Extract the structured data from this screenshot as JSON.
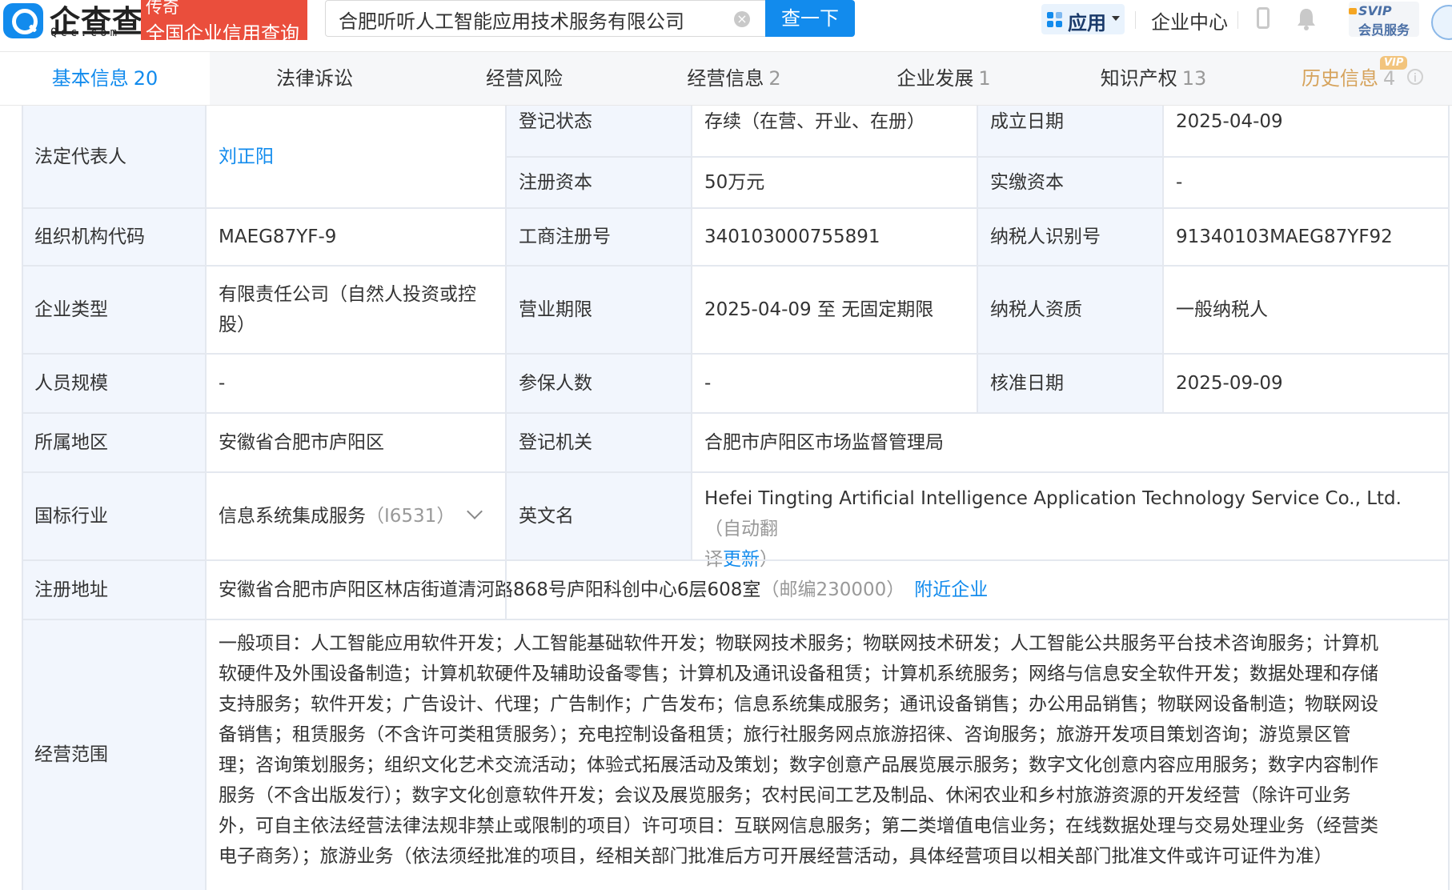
{
  "logo": {
    "name": "企查查",
    "domain": "Qcc.com",
    "badge_line1": "传奇",
    "badge_line2": "全国企业信用查询"
  },
  "search": {
    "value": "合肥听听人工智能应用技术服务有限公司",
    "button_label": "查一下"
  },
  "nav": {
    "apps_label": "应用",
    "enterprise_center": "企业中心",
    "svip_line1": "SVIP",
    "svip_line2": "会员服务"
  },
  "tabs": [
    {
      "label": "基本信息",
      "count": "20"
    },
    {
      "label": "法律诉讼",
      "count": ""
    },
    {
      "label": "经营风险",
      "count": ""
    },
    {
      "label": "经营信息",
      "count": "2"
    },
    {
      "label": "企业发展",
      "count": "1"
    },
    {
      "label": "知识产权",
      "count": "13"
    },
    {
      "label": "历史信息",
      "count": "4",
      "tag": "VIP"
    }
  ],
  "info": {
    "legal_rep_label": "法定代表人",
    "legal_rep_value": "刘正阳",
    "reg_status_label": "登记状态",
    "reg_status_value": "存续（在营、开业、在册）",
    "founded_label": "成立日期",
    "founded_value": "2025-04-09",
    "reg_capital_label": "注册资本",
    "reg_capital_value": "50万元",
    "paid_capital_label": "实缴资本",
    "paid_capital_value": "-",
    "org_code_label": "组织机构代码",
    "org_code_value": "MAEG87YF-9",
    "biz_reg_no_label": "工商注册号",
    "biz_reg_no_value": "340103000755891",
    "taxpayer_id_label": "纳税人识别号",
    "taxpayer_id_value": "91340103MAEG87YF92",
    "company_type_label": "企业类型",
    "company_type_line1": "有限责任公司（自然人投资或控",
    "company_type_line2": "股）",
    "biz_term_label": "营业期限",
    "biz_term_value": "2025-04-09 至 无固定期限",
    "taxpayer_qual_label": "纳税人资质",
    "taxpayer_qual_value": "一般纳税人",
    "staff_size_label": "人员规模",
    "staff_size_value": "-",
    "insured_label": "参保人数",
    "insured_value": "-",
    "approval_date_label": "核准日期",
    "approval_date_value": "2025-09-09",
    "region_label": "所属地区",
    "region_value": "安徽省合肥市庐阳区",
    "reg_authority_label": "登记机关",
    "reg_authority_value": "合肥市庐阳区市场监督管理局",
    "industry_label": "国标行业",
    "industry_value": "信息系统集成服务",
    "industry_code": "（I6531）",
    "english_name_label": "英文名",
    "english_name_value": "Hefei Tingting Artificial Intelligence Application Technology Service Co., Ltd.",
    "english_name_note1": "（自动翻",
    "english_name_note2": "译",
    "english_name_update": "更新",
    "english_name_note3": "）",
    "address_label": "注册地址",
    "address_value": "安徽省合肥市庐阳区林店街道清河路868号庐阳科创中心6层608室",
    "address_postcode": "（邮编230000）",
    "nearby_link": "附近企业",
    "scope_label": "经营范围",
    "scope_lines": [
      "一般项目：人工智能应用软件开发；人工智能基础软件开发；物联网技术服务；物联网技术研发；人工智能公共服务平台技术咨询服务；计算机",
      "软硬件及外围设备制造；计算机软硬件及辅助设备零售；计算机及通讯设备租赁；计算机系统服务；网络与信息安全软件开发；数据处理和存储",
      "支持服务；软件开发；广告设计、代理；广告制作；广告发布；信息系统集成服务；通讯设备销售；办公用品销售；物联网设备制造；物联网设",
      "备销售；租赁服务（不含许可类租赁服务）；充电控制设备租赁；旅行社服务网点旅游招徕、咨询服务；旅游开发项目策划咨询；游览景区管",
      "理；咨询策划服务；组织文化艺术交流活动；体验式拓展活动及策划；数字创意产品展览展示服务；数字文化创意内容应用服务；数字内容制作",
      "服务（不含出版发行）；数字文化创意软件开发；会议及展览服务；农村民间工艺及制品、休闲农业和乡村旅游资源的开发经营（除许可业务",
      "外，可自主依法经营法律法规非禁止或限制的项目）许可项目：互联网信息服务；第二类增值电信业务；在线数据处理与交易处理业务（经营类",
      "电子商务）；旅游业务（依法须经批准的项目，经相关部门批准后方可开展经营活动，具体经营项目以相关部门批准文件或许可证件为准）"
    ]
  }
}
